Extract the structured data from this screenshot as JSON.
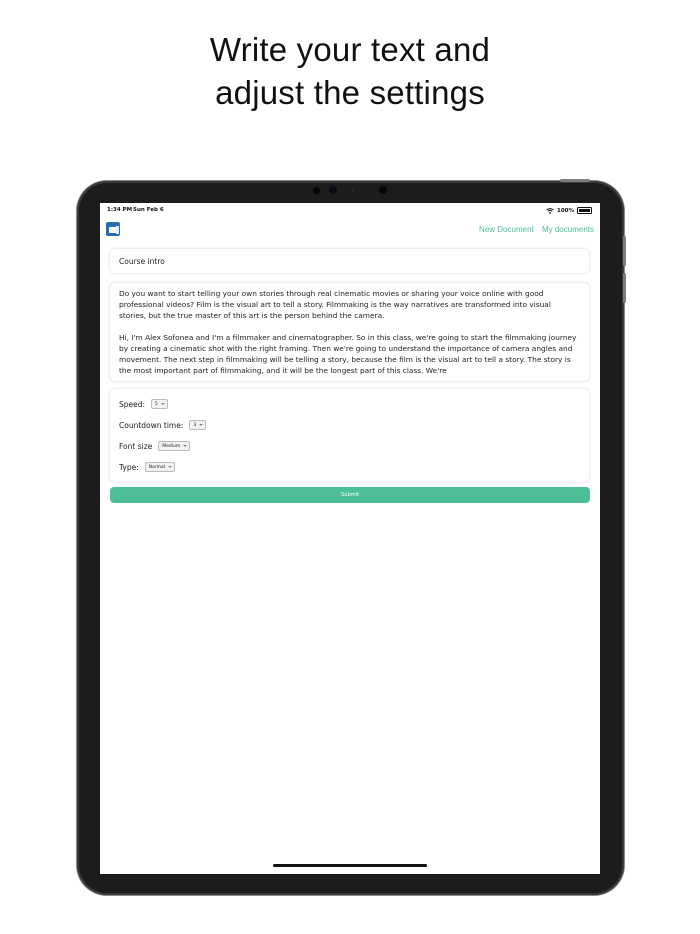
{
  "headline": {
    "line1": "Write your text and",
    "line2": "adjust the settings"
  },
  "status_bar": {
    "time": "1:34 PM",
    "date": "Sun Feb 6",
    "battery": "100%"
  },
  "nav": {
    "new_document": "New Document",
    "my_documents": "My documents"
  },
  "document": {
    "title": "Course intro",
    "paragraph1": "Do you want to start telling your own stories through real cinematic movies or sharing your voice online with good professional videos? Film is the visual art to tell a story. Filmmaking is the way narratives are transformed into visual stories, but the true master of this art is the person behind the camera.",
    "paragraph2": "Hi, I'm Alex Sofonea and I'm a filmmaker and cinematographer. So in this class, we're going to start the filmmaking journey by creating a cinematic shot with the right framing. Then we're going to understand the importance of camera angles and movement. The next step in filmmaking will be telling a story, because the film is the visual art to tell a story. The story is the most important part of filmmaking, and it will be the longest part of this class. We're"
  },
  "settings": {
    "speed_label": "Speed:",
    "speed_value": "5",
    "countdown_label": "Countdown time:",
    "countdown_value": "3",
    "font_size_label": "Font size",
    "font_size_value": "Medium",
    "type_label": "Type:",
    "type_value": "Normal"
  },
  "submit_label": "Submit",
  "colors": {
    "accent": "#4cbf99",
    "device_frame": "#1c1c1c",
    "logo_blue": "#2b6cb0"
  }
}
